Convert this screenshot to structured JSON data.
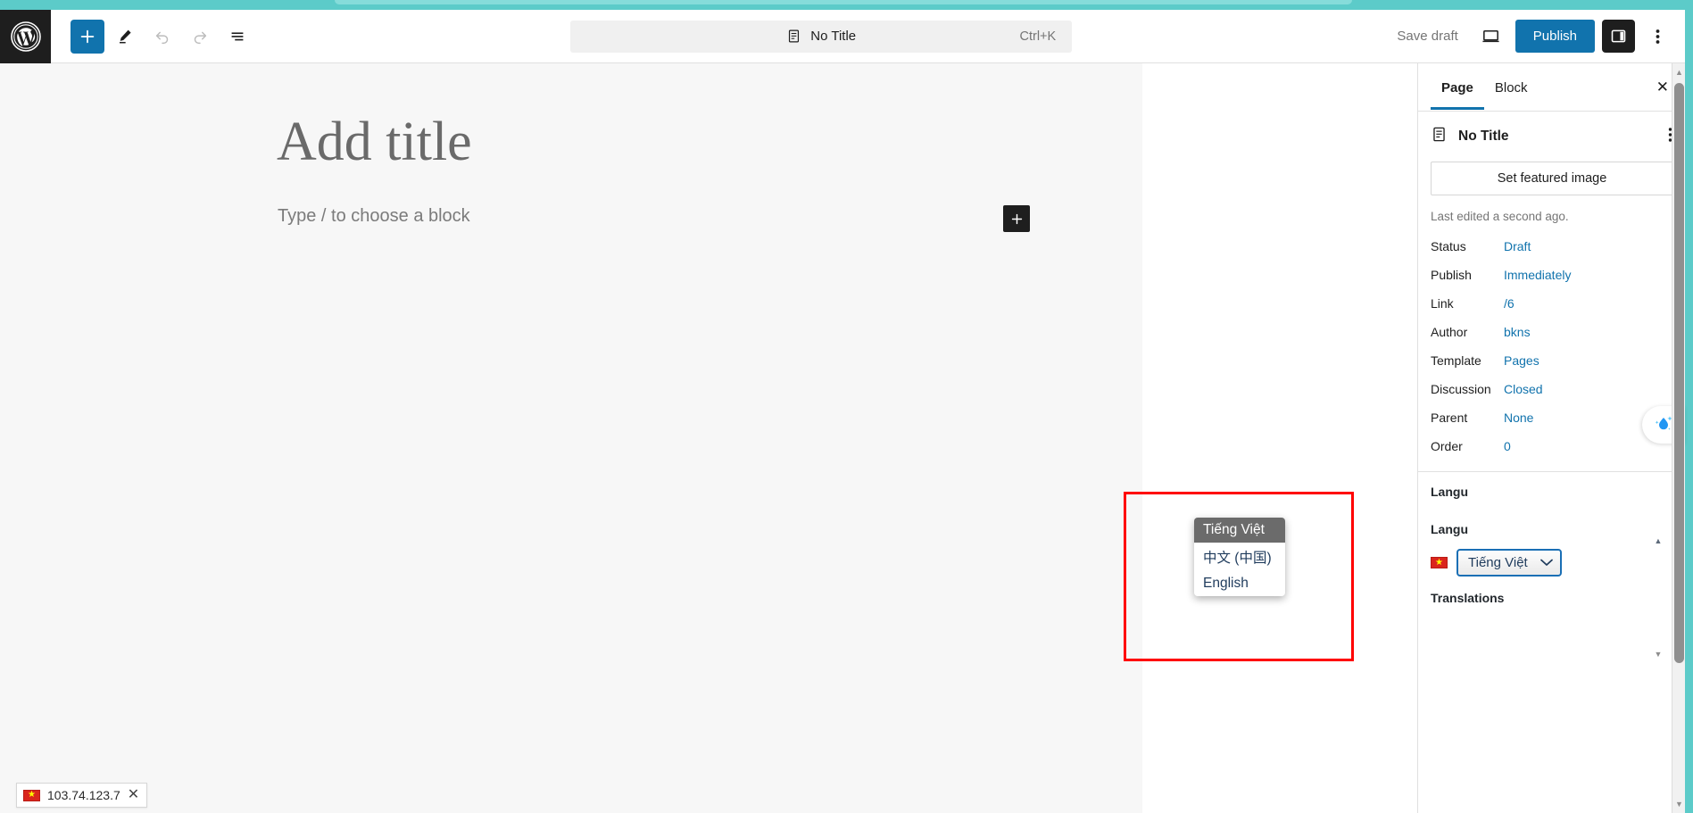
{
  "topbar": {
    "logo_icon": "wordpress-logo-icon",
    "add_block_label": "+",
    "tools": [
      {
        "name": "add-block-button",
        "icon": "plus-icon"
      },
      {
        "name": "edit-tool-button",
        "icon": "pencil-icon"
      },
      {
        "name": "undo-button",
        "icon": "undo-arrow-icon"
      },
      {
        "name": "redo-button",
        "icon": "redo-arrow-icon"
      },
      {
        "name": "list-view-button",
        "icon": "list-view-icon"
      }
    ],
    "command_bar": {
      "icon": "document-icon",
      "title": "No Title",
      "shortcut": "Ctrl+K"
    },
    "save_draft_label": "Save draft",
    "preview_icon": "desktop-preview-icon",
    "publish_label": "Publish",
    "sidebar_toggle_icon": "sidebar-panel-icon",
    "options_icon": "kebab-menu-icon"
  },
  "canvas": {
    "title_placeholder": "Add title",
    "block_placeholder": "Type / to choose a block",
    "inserter_icon": "plus-icon"
  },
  "status_chip": {
    "flag_icon": "vietnam-flag-icon",
    "ip_address": "103.74.123.7",
    "close_icon": "close-icon"
  },
  "sidebar": {
    "tabs": [
      {
        "label": "Page",
        "active": true
      },
      {
        "label": "Block",
        "active": false
      }
    ],
    "close_icon": "close-icon",
    "document": {
      "icon": "document-icon",
      "title": "No Title",
      "options_icon": "kebab-menu-icon"
    },
    "featured_image_label": "Set featured image",
    "last_edited": "Last edited a second ago.",
    "meta_rows": [
      {
        "label": "Status",
        "value": "Draft"
      },
      {
        "label": "Publish",
        "value": "Immediately"
      },
      {
        "label": "Link",
        "value": "/6"
      },
      {
        "label": "Author",
        "value": "bkns"
      },
      {
        "label": "Template",
        "value": "Pages"
      },
      {
        "label": "Discussion",
        "value": "Closed"
      },
      {
        "label": "Parent",
        "value": "None"
      },
      {
        "label": "Order",
        "value": "0"
      }
    ],
    "language_panel": {
      "languages_label": "Langu",
      "language_label": "Langu",
      "flag_icon": "vietnam-flag-icon",
      "selected_language": "Tiếng Việt",
      "chevron_icon": "chevron-down-icon",
      "translations_label": "Translations"
    }
  },
  "dropdown": {
    "options": [
      {
        "label": "Tiếng Việt",
        "selected": true
      },
      {
        "label": "中文 (中国)",
        "selected": false
      },
      {
        "label": "English",
        "selected": false
      }
    ]
  },
  "widgets": {
    "drop_icon": "water-drop-sparkle-icon"
  },
  "scrollbar": {
    "up_arrow": "▲",
    "down_arrow": "▼"
  },
  "colors": {
    "accent_blue": "#1173ad",
    "link_blue": "#1173ad",
    "teal": "#5ccbc9",
    "annotation_red": "#ff0000",
    "dark": "#1e1e1e"
  }
}
